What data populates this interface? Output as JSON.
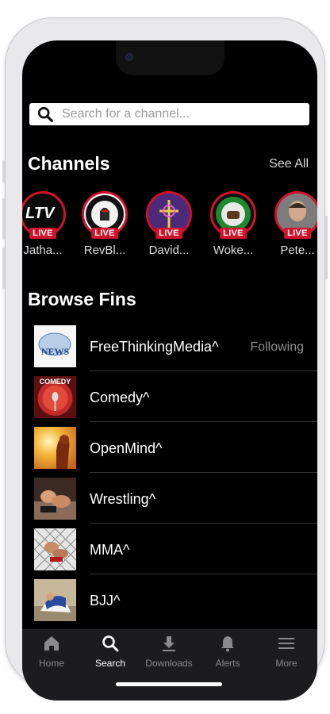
{
  "search": {
    "placeholder": "Search for a channel..."
  },
  "channels_section": {
    "title": "Channels",
    "see_all": "See All"
  },
  "channels": [
    {
      "name": "Jatha...",
      "live": "LIVE",
      "logo_text": "LTV"
    },
    {
      "name": "RevBl...",
      "live": "LIVE"
    },
    {
      "name": "David...",
      "live": "LIVE"
    },
    {
      "name": "Woke...",
      "live": "LIVE"
    },
    {
      "name": "Pete...",
      "live": "LIVE"
    }
  ],
  "browse_section": {
    "title": "Browse Fins"
  },
  "fins": [
    {
      "name": "FreeThinkingMedia^",
      "status": "Following",
      "thumb_text": "NEWS"
    },
    {
      "name": "Comedy^",
      "thumb_text": "COMEDY"
    },
    {
      "name": "OpenMind^"
    },
    {
      "name": "Wrestling^"
    },
    {
      "name": "MMA^"
    },
    {
      "name": "BJJ^"
    }
  ],
  "tabbar": [
    {
      "label": "Home",
      "icon": "home-icon"
    },
    {
      "label": "Search",
      "icon": "search-icon",
      "active": true
    },
    {
      "label": "Downloads",
      "icon": "download-icon"
    },
    {
      "label": "Alerts",
      "icon": "bell-icon"
    },
    {
      "label": "More",
      "icon": "menu-icon"
    }
  ],
  "colors": {
    "live_red": "#d0122c",
    "background": "#000000",
    "tabbar": "#1c1c1e"
  }
}
